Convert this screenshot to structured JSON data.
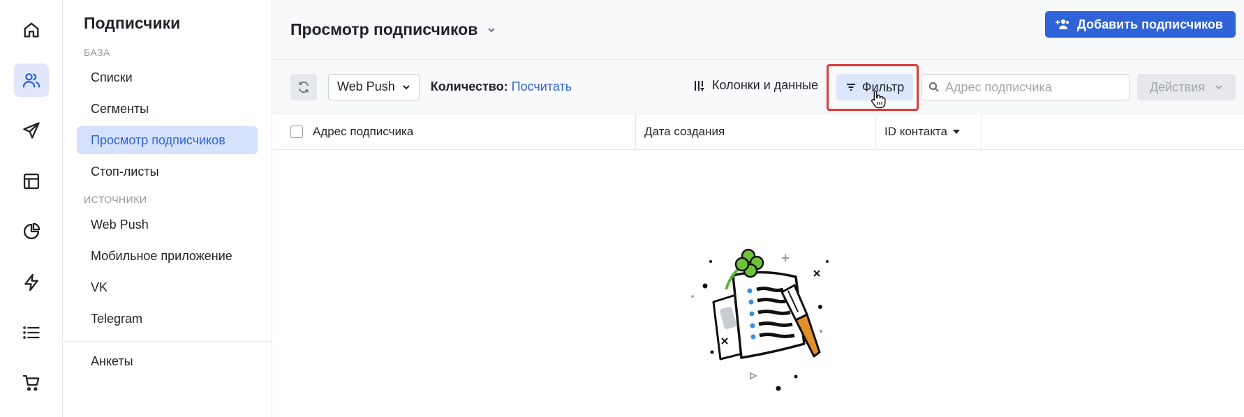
{
  "rail": {
    "items": [
      {
        "icon": "home-icon",
        "active": false
      },
      {
        "icon": "users-icon",
        "active": true
      },
      {
        "icon": "send-icon",
        "active": false
      },
      {
        "icon": "layout-icon",
        "active": false
      },
      {
        "icon": "pie-chart-icon",
        "active": false
      },
      {
        "icon": "lightning-icon",
        "active": false
      },
      {
        "icon": "list-icon",
        "active": false
      },
      {
        "icon": "cart-icon",
        "active": false
      }
    ]
  },
  "sidebar": {
    "title": "Подписчики",
    "section_base": "БАЗА",
    "base_items": [
      "Списки",
      "Сегменты",
      "Просмотр подписчиков",
      "Стоп-листы"
    ],
    "active_item": "Просмотр подписчиков",
    "section_sources": "ИСТОЧНИКИ",
    "source_items": [
      "Web Push",
      "Мобильное приложение",
      "VK",
      "Telegram"
    ],
    "bottom_item": "Анкеты"
  },
  "header": {
    "title": "Просмотр подписчиков",
    "add_button": "Добавить подписчиков"
  },
  "toolbar": {
    "channel_select": "Web Push",
    "count_label": "Количество:",
    "count_link": "Посчитать",
    "columns_button": "Колонки и данные",
    "filter_button": "Фильтр",
    "search_placeholder": "Адрес подписчика",
    "actions_button": "Действия"
  },
  "table": {
    "columns": [
      "Адрес подписчика",
      "Дата создания",
      "ID контакта"
    ]
  },
  "colors": {
    "accent": "#2f63d8",
    "highlight_frame": "#e03838"
  }
}
